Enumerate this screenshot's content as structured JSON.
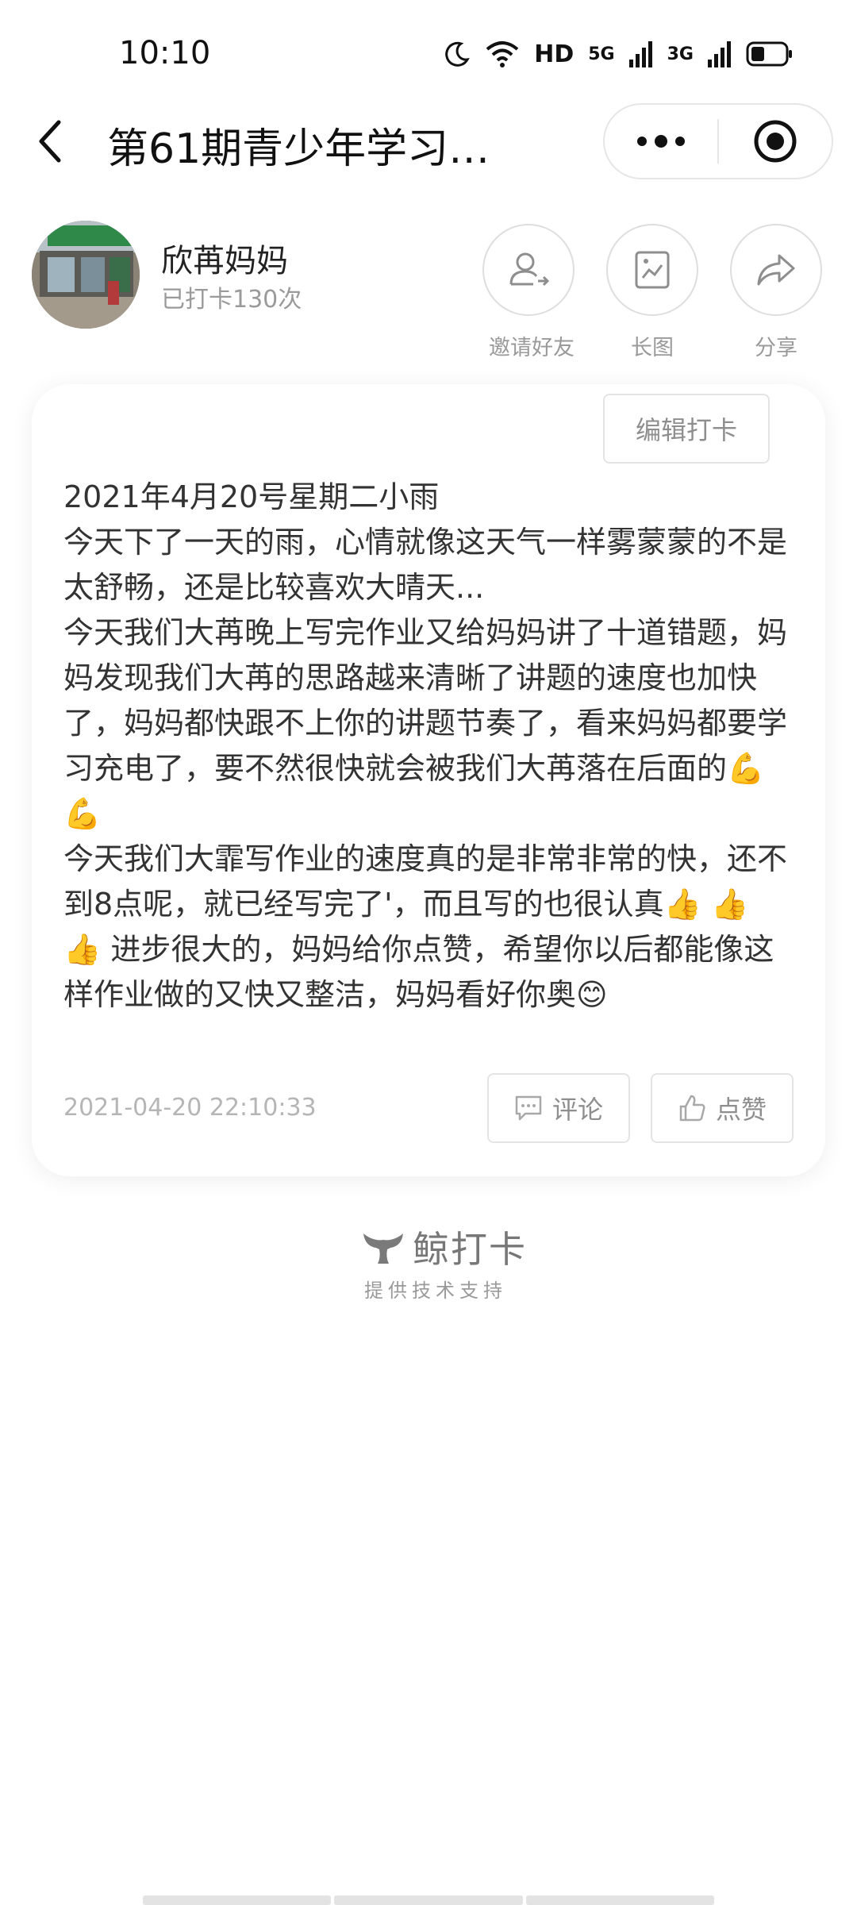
{
  "status_bar": {
    "time": "10:10",
    "hd": "HD",
    "net1": "5G",
    "net2": "3G"
  },
  "header": {
    "title": "第61期青少年学习能...",
    "back_icon": "chevron-left-icon",
    "more_icon": "more-dots-icon",
    "close_icon": "target-close-icon"
  },
  "profile": {
    "name": "欣苒妈妈",
    "checkin_count": "已打卡130次"
  },
  "actions": [
    {
      "label": "邀请好友",
      "icon": "invite-user-icon"
    },
    {
      "label": "长图",
      "icon": "long-image-icon"
    },
    {
      "label": "分享",
      "icon": "share-arrow-icon"
    }
  ],
  "card": {
    "edit_label": "编辑打卡",
    "paragraphs": [
      "2021年4月20号星期二小雨",
      "今天下了一天的雨，心情就像这天气一样雾蒙蒙的不是太舒畅，还是比较喜欢大晴天...",
      "今天我们大苒晚上写完作业又给妈妈讲了十道错题，妈妈发现我们大苒的思路越来清晰了讲题的速度也加快了，妈妈都快跟不上你的讲题节奏了，看来妈妈都要学习充电了，要不然很快就会被我们大苒落在后面的💪 💪",
      "今天我们大霏写作业的速度真的是非常非常的快，还不到8点呢，就已经写完了'，而且写的也很认真👍 👍 👍 进步很大的，妈妈给你点赞，希望你以后都能像这样作业做的又快又整洁，妈妈看好你奥😊"
    ],
    "timestamp": "2021-04-20 22:10:33",
    "comment_label": "评论",
    "like_label": "点赞"
  },
  "footer": {
    "brand": "鲸打卡",
    "tagline": "提供技术支持"
  },
  "colors": {
    "text": "#333333",
    "muted": "#9a9a9a",
    "border": "#e4e4e4"
  }
}
